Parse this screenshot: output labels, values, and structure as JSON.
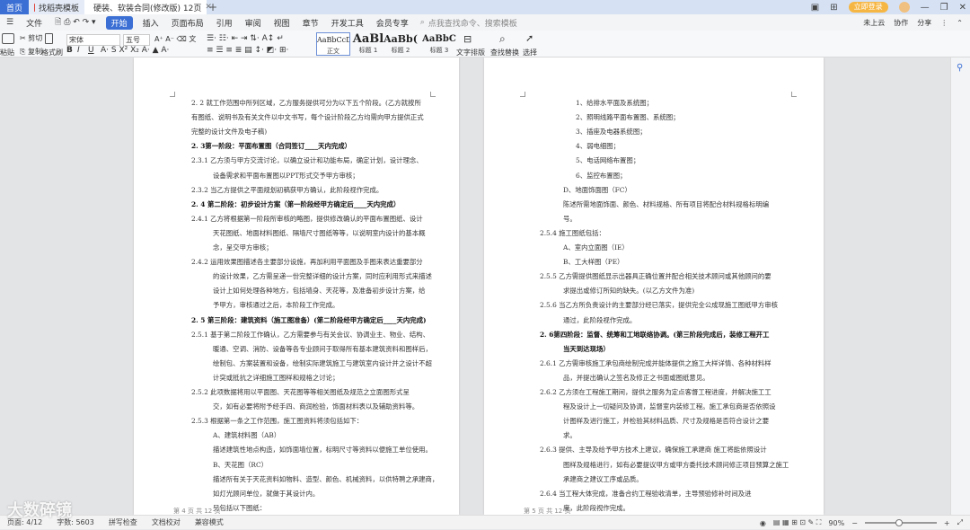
{
  "tabs": {
    "home": "首页",
    "t1": "找稻壳模板",
    "t2": "硬装、软装合同(修改版) 12页"
  },
  "window": {
    "login": "立即登录",
    "min": "—",
    "max": "❐",
    "close": "✕"
  },
  "menus": [
    "文件",
    "开始",
    "插入",
    "页面布局",
    "引用",
    "审阅",
    "视图",
    "章节",
    "开发工具",
    "会员专享"
  ],
  "search_placeholder": "点我查找命令、搜索模板",
  "right_menu": {
    "save": "未上云",
    "collab": "协作",
    "share": "分享"
  },
  "ribbon": {
    "paste": "粘贴",
    "cut": "剪切",
    "copy": "复制",
    "format_painter": "格式刷",
    "font": "宋体",
    "font_size": "五号",
    "styles": [
      {
        "sample": "AaBbCcDc",
        "label": "正文"
      },
      {
        "sample": "AaBl",
        "label": "标题 1"
      },
      {
        "sample": "AaBb(",
        "label": "标题 2"
      },
      {
        "sample": "AaBbC",
        "label": "标题 3"
      }
    ],
    "text_tools": "文字排版",
    "find_replace": "查找替换",
    "select": "选择"
  },
  "page1": {
    "lines": [
      {
        "t": "2. 2 就工作范围中所列区域，乙方服务提供可分为以下五个阶段。(乙方就按所",
        "b": false
      },
      {
        "t": "有图纸、说明书及有关文件以中文书写，每个设计阶段乙方均需向甲方提供正式",
        "b": false
      },
      {
        "t": "完整的设计文件及电子稿)",
        "b": false
      },
      {
        "t": "2. 3第一阶段：平面布置图（合同签订____天内完成）",
        "b": true
      },
      {
        "t": "2.3.1 乙方须与甲方交流讨论，以确立设计和功能布局，确定计划，设计理念、",
        "b": false
      },
      {
        "t": "设备需求和平面布置图以PPT形式交予甲方审核；",
        "b": false
      },
      {
        "t": "2.3.2 当乙方提供之平面规划初稿获甲方确认，此阶段视作完成。",
        "b": false
      },
      {
        "t": "2. 4 第二阶段：初步设计方案（第一阶段经甲方确定后____天内完成）",
        "b": true
      },
      {
        "t": "2.4.1 乙方将根据第一阶段所审核的略图，提供修改确认的平面布置图纸、设计",
        "b": false
      },
      {
        "t": "天花图纸、地面材料图纸、隔墙尺寸图纸等等，以说明室内设计的基本概",
        "b": false
      },
      {
        "t": "念，呈交甲方审核；",
        "b": false
      },
      {
        "t": "2.4.2 运用效果图描述各主要部分设施，再加利用平面图及手图来表达重要部分",
        "b": false
      },
      {
        "t": "的设计效果，乙方需呈递一份完整详细的设计方案，同时应利用形式来描述",
        "b": false
      },
      {
        "t": "设计上如何处理各种地方，包括墙身、天花等，及准备初步设计方案，给",
        "b": false
      },
      {
        "t": "予甲方，审核通过之后，本阶段工作完成。",
        "b": false
      },
      {
        "t": "2. 5 第三阶段：建筑资料（施工图准备）(第二阶段经甲方确定后____天内完成)",
        "b": true
      },
      {
        "t": "2.5.1 基于第二阶段工作确认，乙方需要参与有关会议、协调业主、物业、结构、",
        "b": false
      },
      {
        "t": "暖通、空调、消防、设备等各专业顾问于取得所有基本建筑资料和图样后，",
        "b": false
      },
      {
        "t": "绘制包、方案装置和设备，绘制实际建筑施工与建筑室内设计并之设计不超",
        "b": false
      },
      {
        "t": "计突或抵抗之详细施工图样和规格之讨论；",
        "b": false
      },
      {
        "t": "2.5.2 此项数据将用以平面图、天花图等等相关图纸及规范之立面图形式呈",
        "b": false
      },
      {
        "t": "交，如有必要将附予经手四、商润检验，饰面材料表以及辅助资料等。",
        "b": false
      },
      {
        "t": "2.5.3 根据第一条之工作范围，施工图资料将须包括如下：",
        "b": false
      },
      {
        "t": "A、建筑材料图（AB）",
        "b": false
      },
      {
        "t": "描述建筑性地点构造，如饰面墙位置，标明尺寸等资料以便施工单位使用。",
        "b": false
      },
      {
        "t": "B、天花图（RC）",
        "b": false
      },
      {
        "t": "描述所有关于天花资料如物料、造型、颜色、机械资料，以供特聘之承建商，",
        "b": false
      },
      {
        "t": "如灯光顾问单位，就做于其设计内。",
        "b": false
      },
      {
        "t": "另包括以下图纸：",
        "b": false
      }
    ],
    "footer": "第 4 页 共 12 页"
  },
  "page2": {
    "lines": [
      {
        "t": "1、给排水平面及系统图；",
        "b": false
      },
      {
        "t": "2、照明线路平面布置图、系统图；",
        "b": false
      },
      {
        "t": "3、插座及电器系统图；",
        "b": false
      },
      {
        "t": "4、弱电细图；",
        "b": false
      },
      {
        "t": "5、电话网络布置图；",
        "b": false
      },
      {
        "t": "6、监控布置图；",
        "b": false
      },
      {
        "t": "D、地面饰面图（FC）",
        "b": false
      },
      {
        "t": "陈述所需地面饰面、颜色、材料规格、所有项目将配合材料规格标明编",
        "b": false
      },
      {
        "t": "号。",
        "b": false
      },
      {
        "t": "2.5.4 施工图纸包括：",
        "b": false
      },
      {
        "t": "A、室内立面图（IE）",
        "b": false
      },
      {
        "t": "B、工大样图（PE）",
        "b": false
      },
      {
        "t": "2.5.5 乙方需提供图纸显示出器具正确位置并配合相关技术顾问或其他顾问的要",
        "b": false
      },
      {
        "t": "求提出或修订所知的缺失。(以乙方文件为准)",
        "b": false
      },
      {
        "t": "2.5.6 当乙方所负责设计的主要部分经已落实，提供完全公成现施工图纸甲方审核",
        "b": false
      },
      {
        "t": "通过，此阶段视作完成。",
        "b": false
      },
      {
        "t": "2. 6第四阶段：监督、统筹和工地联络协调。(第三阶段完成后，装修工程开工",
        "b": true
      },
      {
        "t": "当天到达现场）",
        "b": true
      },
      {
        "t": "2.6.1 乙方需审核施工承包商绘制完成并能体提供之施工大样详情、各种材料样",
        "b": false
      },
      {
        "t": "品，并提出确认之签名及修正之书面或图纸意见。",
        "b": false
      },
      {
        "t": "2.6.2 乙方须在工程施工期间，提供之服务为定点客督工程进度，并解决施工工",
        "b": false
      },
      {
        "t": "程及设计上一切疑问及协调，监督室内装修工程。施工承包商是否依照设",
        "b": false
      },
      {
        "t": "计图样及进行施工，并检验其材料品质、尺寸及规格是否符合设计之要",
        "b": false
      },
      {
        "t": "求。",
        "b": false
      },
      {
        "t": "2.6.3 提供、主导及给予甲方技术上建议，确保施工承建商 施工将能依照设计",
        "b": false
      },
      {
        "t": "图样及规格进行，如有必要提议甲方或甲方委托技术顾问修正项目预算之施工",
        "b": false
      },
      {
        "t": "承建商之建议工序或品质。",
        "b": false
      },
      {
        "t": "2.6.4 当工程大体完成，准备合约工程验收清单，主导预验修补时间及进",
        "b": false
      },
      {
        "t": "度，此阶段视作完成。",
        "b": false
      }
    ],
    "footer": "第 5 页 共 12 页"
  },
  "status": {
    "page": "页面: 4/12",
    "words": "字数: 5603",
    "spell": "拼写检查",
    "docproof": "文档校对",
    "compat": "兼容模式",
    "zoom": "90%"
  },
  "watermark": "大数碎镜"
}
